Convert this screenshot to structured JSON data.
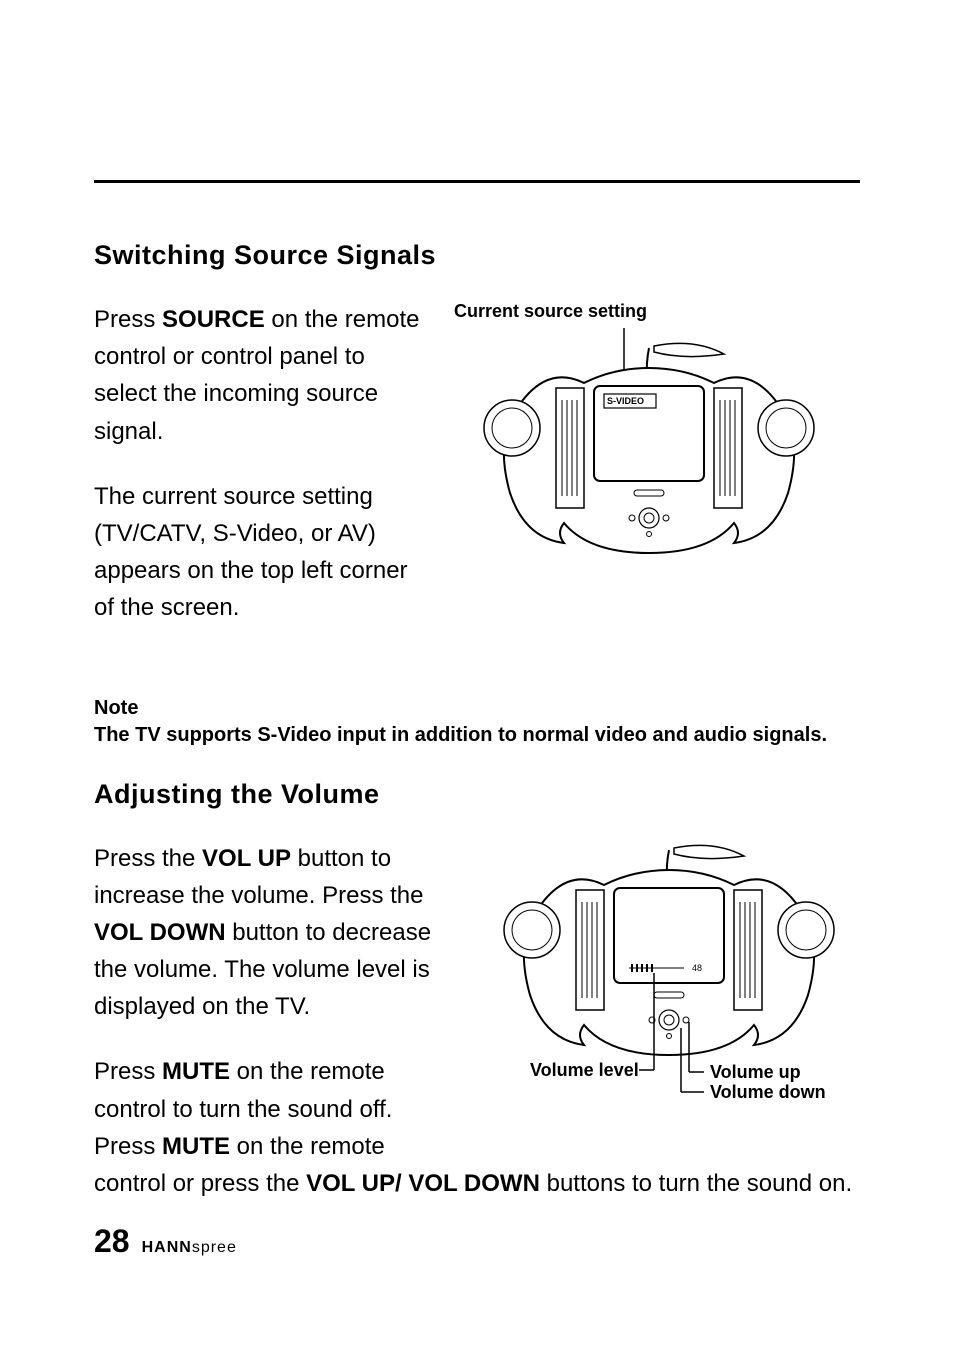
{
  "headings": {
    "h1": "Switching Source Signals",
    "h2": "Adjusting the Volume"
  },
  "section1": {
    "p1_a": "Press ",
    "p1_b": "SOURCE",
    "p1_c": " on the remote control or control panel to select the incoming source signal.",
    "p2": "The current source setting (TV/CATV, S-Video, or AV) appears on the top left corner of the screen.",
    "callout": "Current source setting",
    "screen_label": "S-VIDEO"
  },
  "note": {
    "label": "Note",
    "text": "The TV supports S-Video input in addition to normal video and audio signals."
  },
  "section2": {
    "p1_a": "Press the ",
    "p1_b": "VOL UP",
    "p1_c": " button to increase the volume. Press the ",
    "p1_d": "VOL DOWN",
    "p1_e": " button to decrease the volume. The volume level is displayed on the TV.",
    "p2_a": "Press ",
    "p2_b": "MUTE",
    "p2_c": " on the remote control to turn the sound off. Press ",
    "p2_d": "MUTE",
    "p2_e": " on the remote control or press the ",
    "p2_f": "VOL UP/ VOL DOWN",
    "p2_g": " buttons to turn the sound on.",
    "callout_level": "Volume level",
    "callout_up": "Volume up",
    "callout_down": "Volume down",
    "vol_number": "48"
  },
  "footer": {
    "page": "28",
    "brand1": "HANN",
    "brand2": "spree"
  }
}
